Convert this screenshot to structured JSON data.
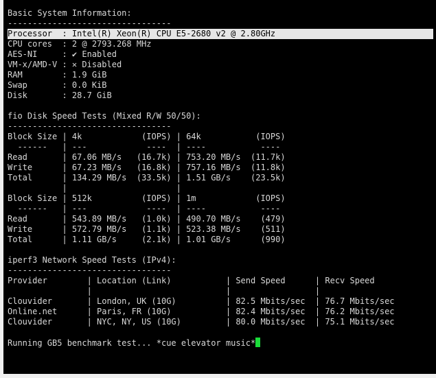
{
  "colors": {
    "terminal_bg": "#000000",
    "text": "#d8d8d8",
    "highlight_bg": "#e6e6e6",
    "highlight_text": "#000000",
    "cursor": "#1bdc3a",
    "page_bg": "#f0f0f0"
  },
  "terminal": {
    "lines": [
      "Basic System Information:",
      "---------------------------------",
      "Processor  : Intel(R) Xeon(R) CPU E5-2680 v2 @ 2.80GHz",
      "CPU cores  : 2 @ 2793.268 MHz",
      "AES-NI     : ✔ Enabled",
      "VM-x/AMD-V : ✕ Disabled",
      "RAM        : 1.9 GiB",
      "Swap       : 0.0 KiB",
      "Disk       : 28.7 GiB",
      "",
      "fio Disk Speed Tests (Mixed R/W 50/50):",
      "---------------------------------",
      "Block Size | 4k            (IOPS) | 64k           (IOPS)",
      "  ------   | ---            ----  | ----           ----",
      "Read       | 67.06 MB/s   (16.7k) | 753.20 MB/s  (11.7k)",
      "Write      | 67.23 MB/s   (16.8k) | 757.16 MB/s  (11.8k)",
      "Total      | 134.29 MB/s  (33.5k) | 1.51 GB/s    (23.5k)",
      "           |                      |",
      "Block Size | 512k          (IOPS) | 1m            (IOPS)",
      "  ------   | ---            ----  | ----           ----",
      "Read       | 543.89 MB/s   (1.0k) | 490.70 MB/s    (479)",
      "Write      | 572.79 MB/s   (1.1k) | 523.38 MB/s    (511)",
      "Total      | 1.11 GB/s     (2.1k) | 1.01 GB/s      (990)",
      "",
      "iperf3 Network Speed Tests (IPv4):",
      "---------------------------------",
      "Provider        | Location (Link)           | Send Speed      | Recv Speed",
      "                |                           |                 |",
      "Clouvider       | London, UK (10G)          | 82.5 Mbits/sec  | 76.7 Mbits/sec",
      "Online.net      | Paris, FR (10G)           | 82.4 Mbits/sec  | 76.2 Mbits/sec",
      "Clouvider       | NYC, NY, US (10G)         | 80.0 Mbits/sec  | 75.1 Mbits/sec",
      "",
      "Running GB5 benchmark test... *cue elevator music*"
    ],
    "highlighted_line": 2,
    "cursor_icon": "block-cursor-icon"
  }
}
